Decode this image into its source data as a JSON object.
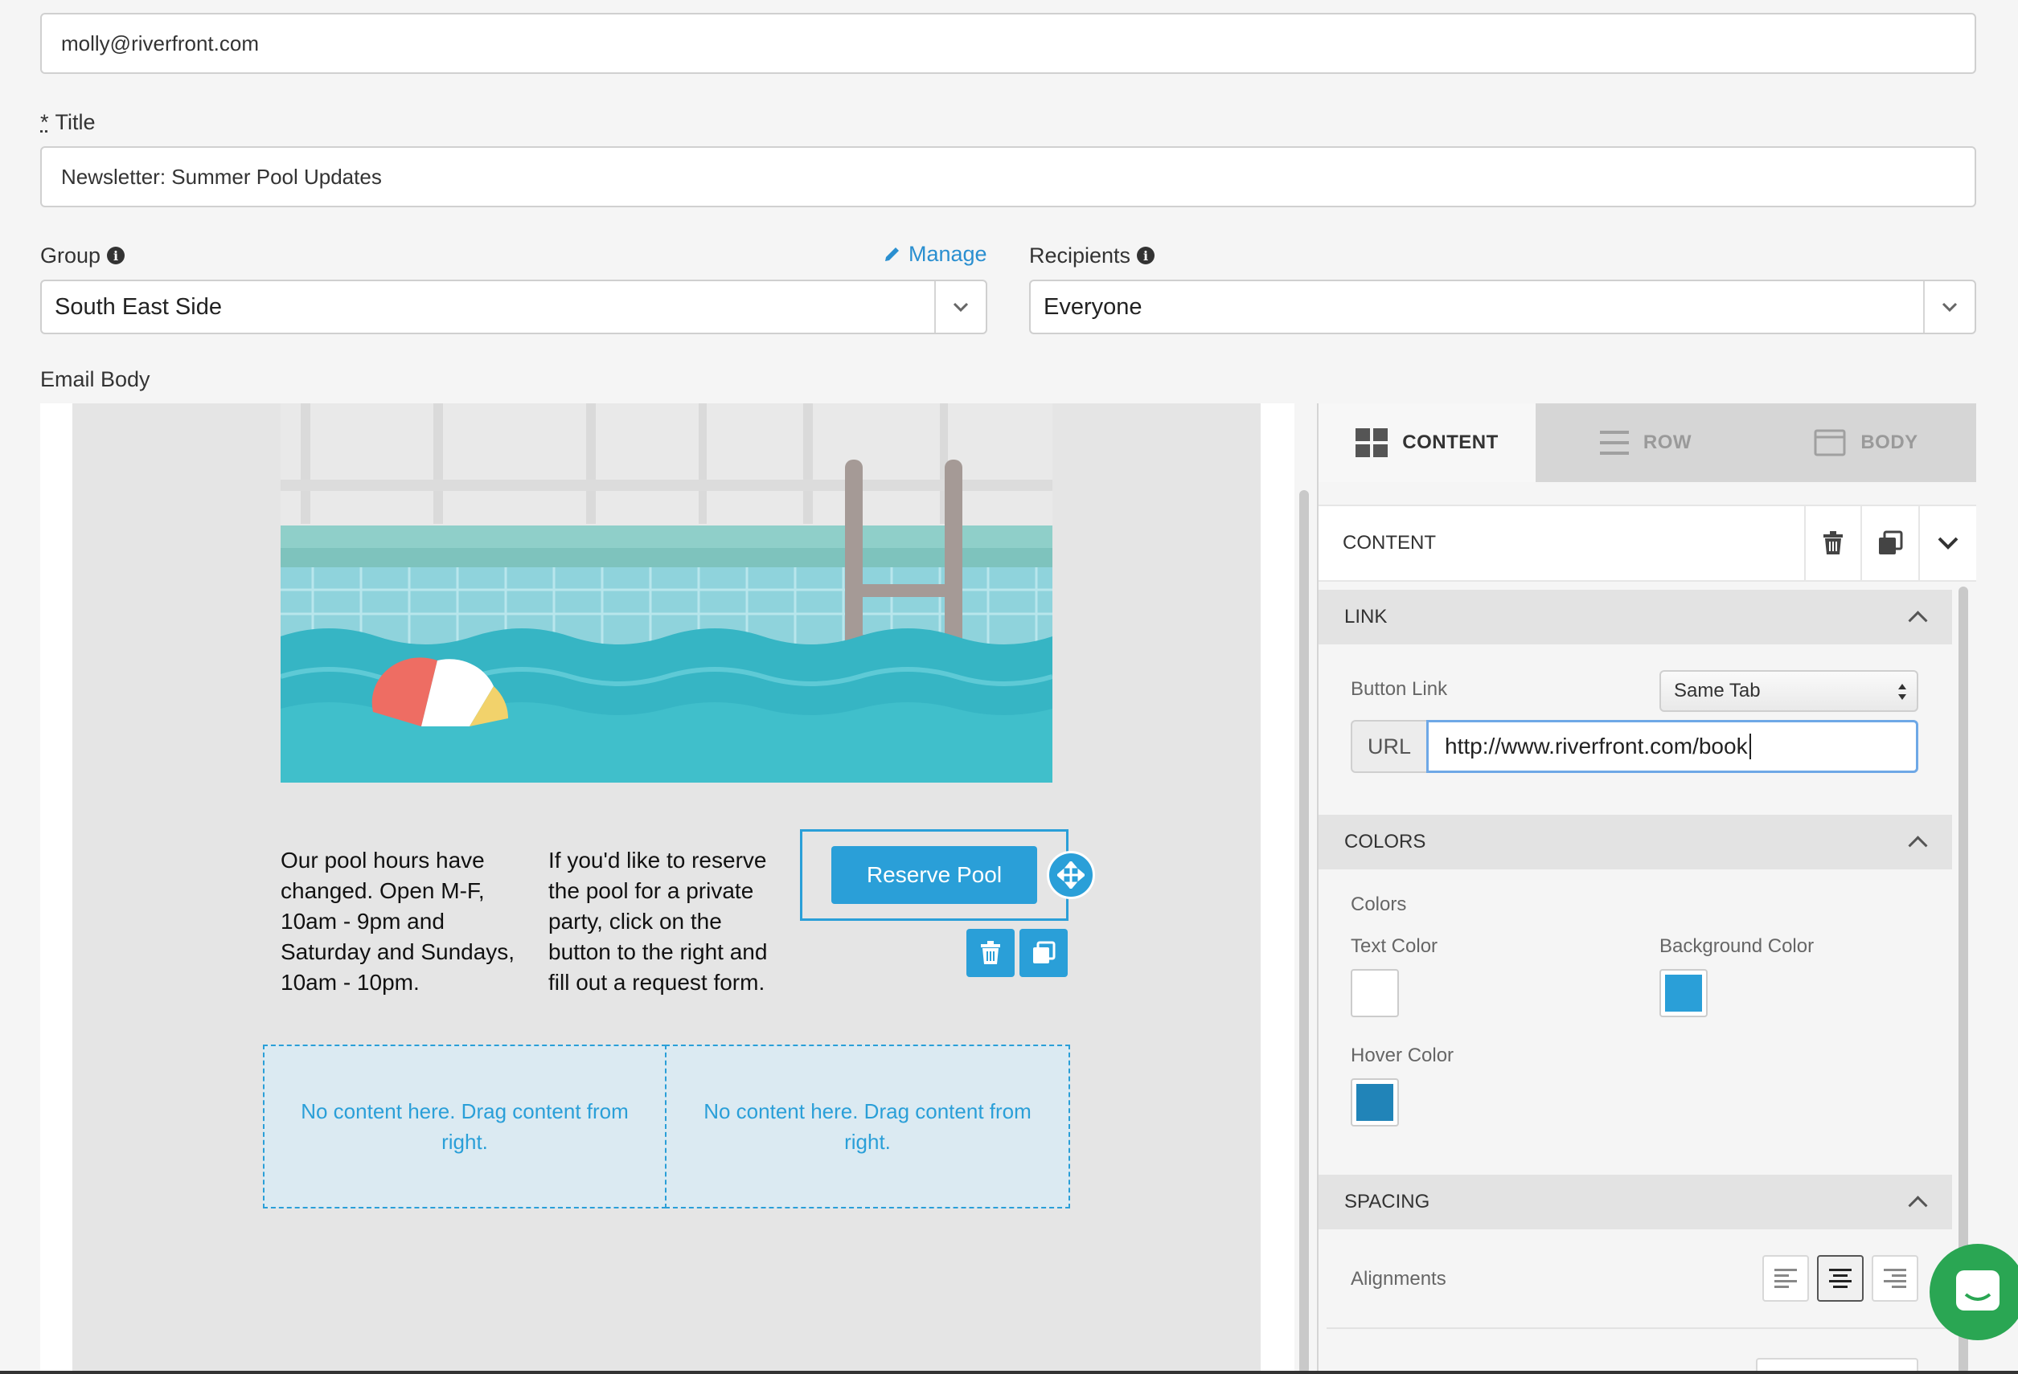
{
  "form": {
    "email_value": "molly@riverfront.com",
    "title_label": "Title",
    "title_required": "*",
    "title_value": "Newsletter: Summer Pool Updates",
    "group_label": "Group",
    "manage_label": "Manage",
    "group_value": "South East Side",
    "recipients_label": "Recipients",
    "recipients_value": "Everyone",
    "email_body_label": "Email Body"
  },
  "email": {
    "hours_text": "Our pool hours have changed. Open M-F, 10am - 9pm and Saturday and Sundays, 10am - 10pm.",
    "reserve_text": "If you'd like to reserve the pool for a private party, click on the button to the right and fill out a request form.",
    "button_label": "Reserve Pool",
    "empty_left": "No content here. Drag content from right.",
    "empty_right": "No content here. Drag content from right."
  },
  "panel": {
    "tabs": [
      {
        "label": "CONTENT",
        "icon": "grid-icon",
        "active": true
      },
      {
        "label": "ROW",
        "icon": "rows-icon",
        "active": false
      },
      {
        "label": "BODY",
        "icon": "layout-icon",
        "active": false
      }
    ],
    "header_title": "CONTENT",
    "link": {
      "title": "LINK",
      "button_link_label": "Button Link",
      "target_value": "Same Tab",
      "url_prefix": "URL",
      "url_value": "http://www.riverfront.com/book"
    },
    "colors": {
      "title": "COLORS",
      "group_label": "Colors",
      "text_color_label": "Text Color",
      "text_color": "#ffffff",
      "background_color_label": "Background Color",
      "background_color": "#2a9fd8",
      "hover_color_label": "Hover Color",
      "hover_color": "#2184b8"
    },
    "spacing": {
      "title": "SPACING",
      "alignments_label": "Alignments",
      "selected_alignment": "center"
    }
  },
  "colors": {
    "accent": "#2a9fd8",
    "chat_bubble": "#2aa653"
  }
}
